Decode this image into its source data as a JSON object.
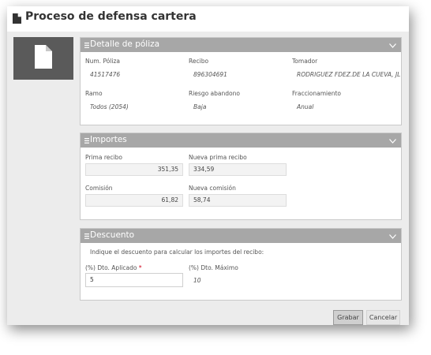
{
  "dialog": {
    "title": "Proceso de defensa cartera"
  },
  "poliza": {
    "header": "Detalle de póliza",
    "fields": [
      {
        "label": "Num. Póliza",
        "value": "41517476"
      },
      {
        "label": "Recibo",
        "value": "896304691"
      },
      {
        "label": "Tomador",
        "value": "RODRIGUEZ FDEZ.DE LA CUEVA, JL"
      },
      {
        "label": "Ramo",
        "value": "Todos (2054)"
      },
      {
        "label": "Riesgo abandono",
        "value": "Baja"
      },
      {
        "label": "Fraccionamiento",
        "value": "Anual"
      }
    ]
  },
  "importes": {
    "header": "Importes",
    "prima_label": "Prima recibo",
    "prima_value": "351,35",
    "nueva_prima_label": "Nueva prima recibo",
    "nueva_prima_value": "334,59",
    "comision_label": "Comisión",
    "comision_value": "61,82",
    "nueva_comision_label": "Nueva comisión",
    "nueva_comision_value": "58,74"
  },
  "descuento": {
    "header": "Descuento",
    "instruction": "Indique el descuento para calcular los importes del recibo:",
    "aplicado_label": "(%) Dto. Aplicado",
    "required_mark": "*",
    "aplicado_value": "5",
    "maximo_label": "(%) Dto. Máximo",
    "maximo_value": "10"
  },
  "buttons": {
    "grabar": "Grabar",
    "cancelar": "Cancelar"
  },
  "colors": {
    "panel_header": "#a7a7a7",
    "content_bg": "#ececec",
    "thumb_bg": "#5a5a5a",
    "required": "#d0021b"
  },
  "icons": [
    "document-icon",
    "file-icon",
    "menu-icon",
    "chevron-down-icon"
  ]
}
